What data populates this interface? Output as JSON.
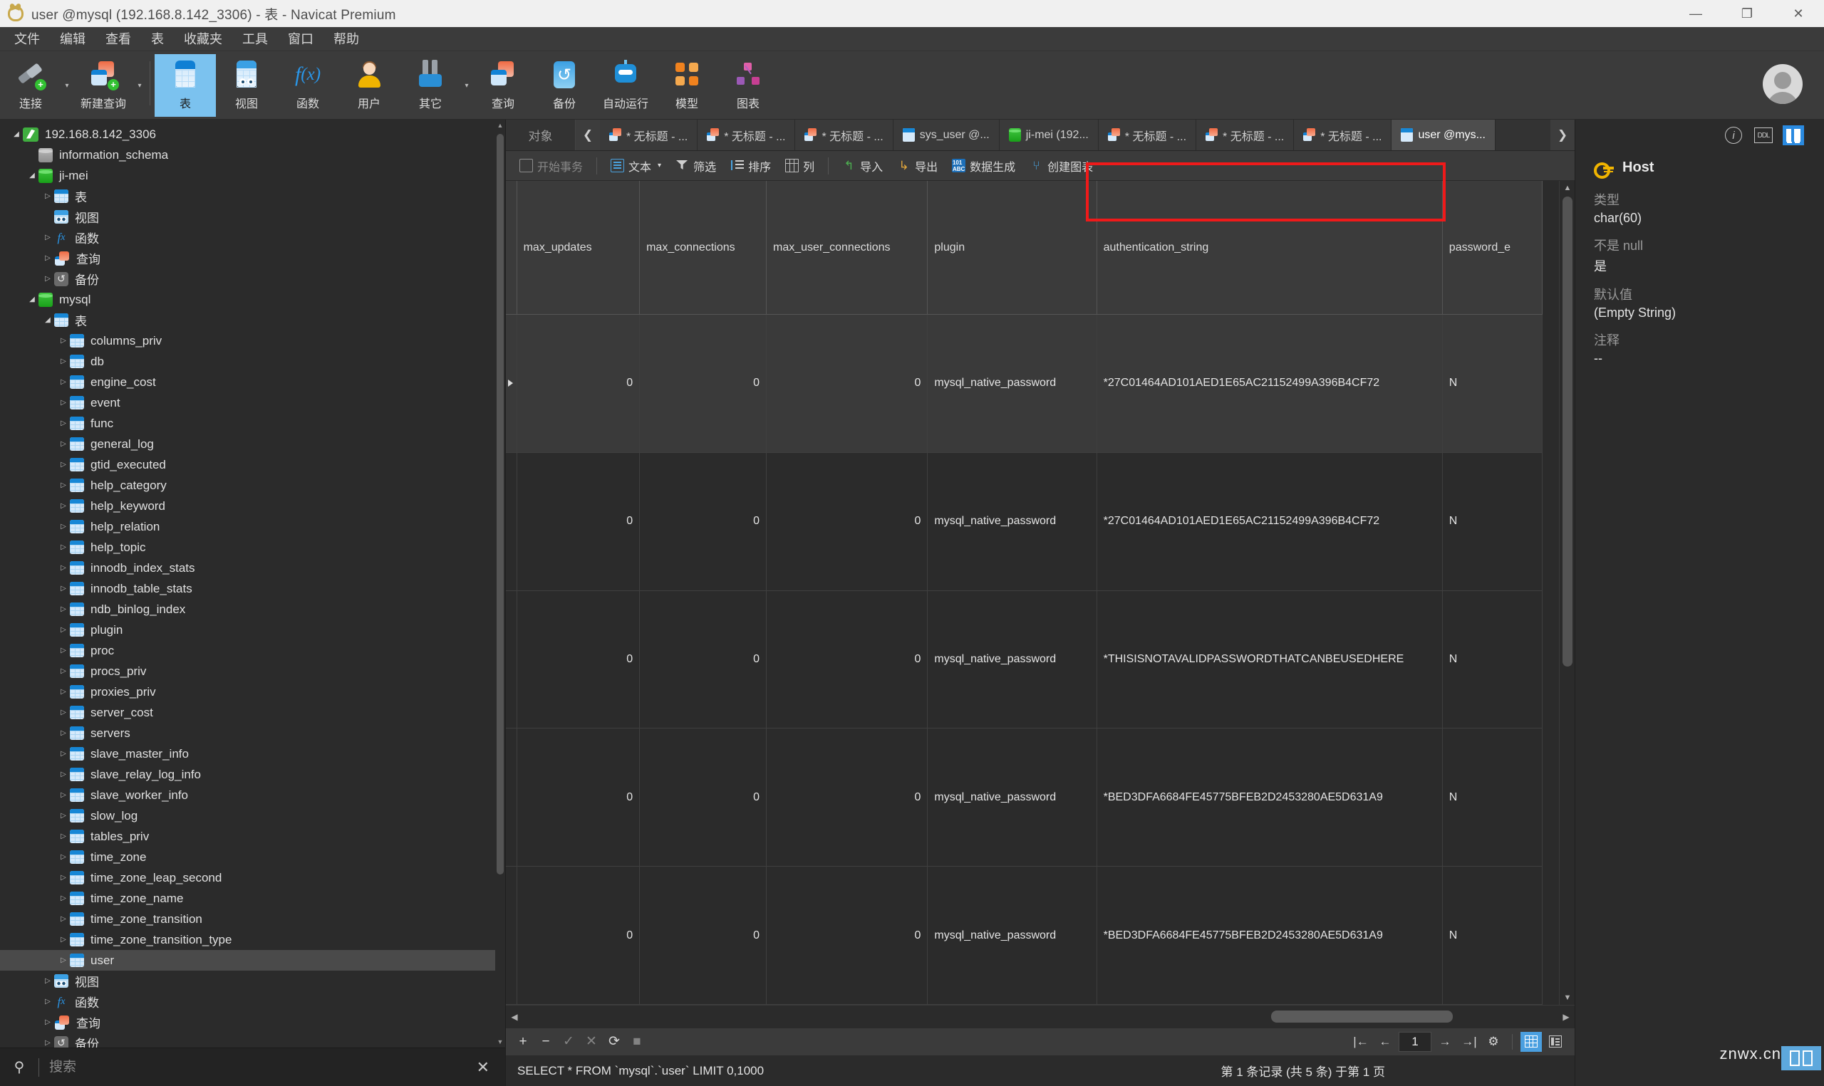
{
  "window": {
    "title": "user @mysql (192.168.8.142_3306) - 表 - Navicat Premium",
    "minimize": "—",
    "maximize": "❐",
    "close": "✕"
  },
  "menubar": [
    "文件",
    "编辑",
    "查看",
    "表",
    "收藏夹",
    "工具",
    "窗口",
    "帮助"
  ],
  "toolbar": [
    {
      "label": "连接",
      "icon": "connection-icon"
    },
    {
      "label": "新建查询",
      "icon": "new-query-icon"
    },
    {
      "label": "表",
      "icon": "table-icon",
      "active": true
    },
    {
      "label": "视图",
      "icon": "view-icon"
    },
    {
      "label": "函数",
      "icon": "function-icon"
    },
    {
      "label": "用户",
      "icon": "user-icon"
    },
    {
      "label": "其它",
      "icon": "others-icon"
    },
    {
      "label": "查询",
      "icon": "query-icon"
    },
    {
      "label": "备份",
      "icon": "backup-icon"
    },
    {
      "label": "自动运行",
      "icon": "automation-icon"
    },
    {
      "label": "模型",
      "icon": "model-icon"
    },
    {
      "label": "图表",
      "icon": "chart-icon"
    }
  ],
  "sidebar": {
    "search_placeholder": "搜索",
    "close_label": "✕",
    "tree": [
      {
        "label": "192.168.8.142_3306",
        "indent": 0,
        "icon": "connection-icon",
        "twisty": "open"
      },
      {
        "label": "information_schema",
        "indent": 1,
        "icon": "database-grey-icon",
        "twisty": "none"
      },
      {
        "label": "ji-mei",
        "indent": 1,
        "icon": "database-green-icon",
        "twisty": "open"
      },
      {
        "label": "表",
        "indent": 2,
        "icon": "table-folder-icon",
        "twisty": "closed"
      },
      {
        "label": "视图",
        "indent": 2,
        "icon": "view-folder-icon",
        "twisty": "none"
      },
      {
        "label": "函数",
        "indent": 2,
        "icon": "function-folder-icon",
        "twisty": "closed"
      },
      {
        "label": "查询",
        "indent": 2,
        "icon": "query-folder-icon",
        "twisty": "closed"
      },
      {
        "label": "备份",
        "indent": 2,
        "icon": "backup-folder-icon",
        "twisty": "closed"
      },
      {
        "label": "mysql",
        "indent": 1,
        "icon": "database-green-icon",
        "twisty": "open"
      },
      {
        "label": "表",
        "indent": 2,
        "icon": "table-folder-icon",
        "twisty": "open"
      },
      {
        "label": "columns_priv",
        "indent": 3,
        "icon": "table-icon",
        "twisty": "closed"
      },
      {
        "label": "db",
        "indent": 3,
        "icon": "table-icon",
        "twisty": "closed"
      },
      {
        "label": "engine_cost",
        "indent": 3,
        "icon": "table-icon",
        "twisty": "closed"
      },
      {
        "label": "event",
        "indent": 3,
        "icon": "table-icon",
        "twisty": "closed"
      },
      {
        "label": "func",
        "indent": 3,
        "icon": "table-icon",
        "twisty": "closed"
      },
      {
        "label": "general_log",
        "indent": 3,
        "icon": "table-icon",
        "twisty": "closed"
      },
      {
        "label": "gtid_executed",
        "indent": 3,
        "icon": "table-icon",
        "twisty": "closed"
      },
      {
        "label": "help_category",
        "indent": 3,
        "icon": "table-icon",
        "twisty": "closed"
      },
      {
        "label": "help_keyword",
        "indent": 3,
        "icon": "table-icon",
        "twisty": "closed"
      },
      {
        "label": "help_relation",
        "indent": 3,
        "icon": "table-icon",
        "twisty": "closed"
      },
      {
        "label": "help_topic",
        "indent": 3,
        "icon": "table-icon",
        "twisty": "closed"
      },
      {
        "label": "innodb_index_stats",
        "indent": 3,
        "icon": "table-icon",
        "twisty": "closed"
      },
      {
        "label": "innodb_table_stats",
        "indent": 3,
        "icon": "table-icon",
        "twisty": "closed"
      },
      {
        "label": "ndb_binlog_index",
        "indent": 3,
        "icon": "table-icon",
        "twisty": "closed"
      },
      {
        "label": "plugin",
        "indent": 3,
        "icon": "table-icon",
        "twisty": "closed"
      },
      {
        "label": "proc",
        "indent": 3,
        "icon": "table-icon",
        "twisty": "closed"
      },
      {
        "label": "procs_priv",
        "indent": 3,
        "icon": "table-icon",
        "twisty": "closed"
      },
      {
        "label": "proxies_priv",
        "indent": 3,
        "icon": "table-icon",
        "twisty": "closed"
      },
      {
        "label": "server_cost",
        "indent": 3,
        "icon": "table-icon",
        "twisty": "closed"
      },
      {
        "label": "servers",
        "indent": 3,
        "icon": "table-icon",
        "twisty": "closed"
      },
      {
        "label": "slave_master_info",
        "indent": 3,
        "icon": "table-icon",
        "twisty": "closed"
      },
      {
        "label": "slave_relay_log_info",
        "indent": 3,
        "icon": "table-icon",
        "twisty": "closed"
      },
      {
        "label": "slave_worker_info",
        "indent": 3,
        "icon": "table-icon",
        "twisty": "closed"
      },
      {
        "label": "slow_log",
        "indent": 3,
        "icon": "table-icon",
        "twisty": "closed"
      },
      {
        "label": "tables_priv",
        "indent": 3,
        "icon": "table-icon",
        "twisty": "closed"
      },
      {
        "label": "time_zone",
        "indent": 3,
        "icon": "table-icon",
        "twisty": "closed"
      },
      {
        "label": "time_zone_leap_second",
        "indent": 3,
        "icon": "table-icon",
        "twisty": "closed"
      },
      {
        "label": "time_zone_name",
        "indent": 3,
        "icon": "table-icon",
        "twisty": "closed"
      },
      {
        "label": "time_zone_transition",
        "indent": 3,
        "icon": "table-icon",
        "twisty": "closed"
      },
      {
        "label": "time_zone_transition_type",
        "indent": 3,
        "icon": "table-icon",
        "twisty": "closed"
      },
      {
        "label": "user",
        "indent": 3,
        "icon": "table-icon",
        "twisty": "closed",
        "selected": true
      },
      {
        "label": "视图",
        "indent": 2,
        "icon": "view-folder-icon",
        "twisty": "closed"
      },
      {
        "label": "函数",
        "indent": 2,
        "icon": "function-folder-icon",
        "twisty": "closed"
      },
      {
        "label": "查询",
        "indent": 2,
        "icon": "query-folder-icon",
        "twisty": "closed"
      },
      {
        "label": "备份",
        "indent": 2,
        "icon": "backup-folder-icon",
        "twisty": "closed"
      }
    ]
  },
  "tabbar": {
    "object_label": "对象",
    "prev_arrow": "❮",
    "next_arrow": "❯",
    "tabs": [
      {
        "label": "* 无标题 - ...",
        "icon": "query-icon",
        "modified": true
      },
      {
        "label": "* 无标题 - ...",
        "icon": "query-icon",
        "modified": true
      },
      {
        "label": "* 无标题 - ...",
        "icon": "query-icon",
        "modified": true
      },
      {
        "label": "sys_user @...",
        "icon": "table-icon",
        "modified": false
      },
      {
        "label": "ji-mei (192...",
        "icon": "database-green-icon",
        "modified": false
      },
      {
        "label": "* 无标题 - ...",
        "icon": "query-icon",
        "modified": true
      },
      {
        "label": "* 无标题 - ...",
        "icon": "query-icon",
        "modified": true
      },
      {
        "label": "* 无标题 - ...",
        "icon": "query-icon",
        "modified": true
      },
      {
        "label": "user @mys...",
        "icon": "table-icon",
        "modified": false,
        "active": true
      }
    ]
  },
  "grid_toolbar": [
    {
      "label": "开始事务",
      "icon": "transaction-icon",
      "dim": true
    },
    {
      "label": "文本",
      "icon": "text-icon",
      "caret": true
    },
    {
      "label": "筛选",
      "icon": "filter-icon"
    },
    {
      "label": "排序",
      "icon": "sort-icon"
    },
    {
      "label": "列",
      "icon": "columns-icon"
    },
    {
      "label": "导入",
      "icon": "import-icon"
    },
    {
      "label": "导出",
      "icon": "export-icon"
    },
    {
      "label": "数据生成",
      "icon": "data-generation-icon"
    },
    {
      "label": "创建图表",
      "icon": "create-chart-icon"
    }
  ],
  "grid": {
    "columns": [
      "max_updates",
      "max_connections",
      "max_user_connections",
      "plugin",
      "authentication_string",
      "password_e"
    ],
    "rows": [
      {
        "max_updates": "0",
        "max_connections": "0",
        "max_user_connections": "0",
        "plugin": "mysql_native_password",
        "authentication_string": "*27C01464AD101AED1E65AC21152499A396B4CF72",
        "password_e": "N",
        "current": true
      },
      {
        "max_updates": "0",
        "max_connections": "0",
        "max_user_connections": "0",
        "plugin": "mysql_native_password",
        "authentication_string": "*27C01464AD101AED1E65AC21152499A396B4CF72",
        "password_e": "N"
      },
      {
        "max_updates": "0",
        "max_connections": "0",
        "max_user_connections": "0",
        "plugin": "mysql_native_password",
        "authentication_string": "*THISISNOTAVALIDPASSWORDTHATCANBEUSEDHERE",
        "password_e": "N"
      },
      {
        "max_updates": "0",
        "max_connections": "0",
        "max_user_connections": "0",
        "plugin": "mysql_native_password",
        "authentication_string": "*BED3DFA6684FE45775BFEB2D2453280AE5D631A9",
        "password_e": "N"
      },
      {
        "max_updates": "0",
        "max_connections": "0",
        "max_user_connections": "0",
        "plugin": "mysql_native_password",
        "authentication_string": "*BED3DFA6684FE45775BFEB2D2453280AE5D631A9",
        "password_e": "N"
      }
    ]
  },
  "edit_bar": {
    "add": "+",
    "remove": "−",
    "confirm": "✓",
    "cancel": "✕",
    "refresh": "⟳",
    "stop": "■"
  },
  "pager": {
    "first": "|←",
    "prev": "←",
    "page": "1",
    "next": "→",
    "last": "→|",
    "settings": "⚙",
    "grid_view": "grid-view-icon",
    "form_view": "form-view-icon"
  },
  "statusbar": {
    "sql": "SELECT * FROM `mysql`.`user` LIMIT 0,1000",
    "record_info": "第 1 条记录 (共 5 条) 于第 1 页"
  },
  "rightpanel": {
    "tabs": [
      {
        "icon": "info-icon",
        "on": false
      },
      {
        "icon": "ddl-icon",
        "on": false
      },
      {
        "icon": "columns-panel-icon",
        "on": true
      }
    ],
    "field_icon": "primary-key-icon",
    "field_name": "Host",
    "properties": [
      {
        "label": "类型",
        "value": "char(60)"
      },
      {
        "label": "不是 null",
        "value": "是"
      },
      {
        "label": "默认值",
        "value": "(Empty String)"
      },
      {
        "label": "注释",
        "value": "--"
      }
    ]
  },
  "watermark": {
    "text": "znwx.cn"
  },
  "colors": {
    "accent": "#2a8ae0",
    "toolbar_active": "#7bc2ef",
    "highlight_box": "#ef1a1a",
    "titlebar_bg": "#f0f0f0",
    "panel_bg": "#2b2b2b",
    "bar_bg": "#3b3b3b"
  }
}
